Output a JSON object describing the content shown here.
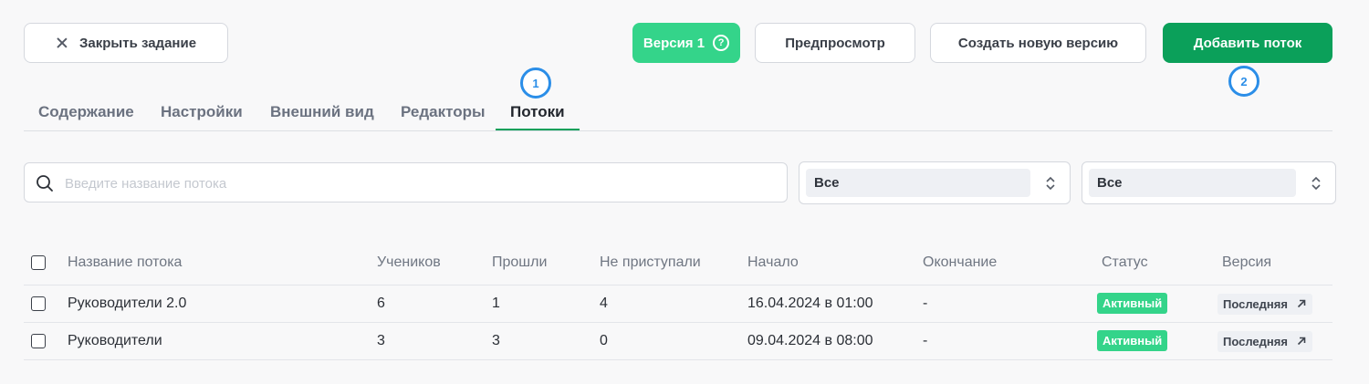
{
  "toolbar": {
    "close_label": "Закрыть задание",
    "version_label": "Версия 1",
    "help_glyph": "?",
    "preview_label": "Предпросмотр",
    "new_version_label": "Создать новую версию",
    "add_stream_label": "Добавить поток"
  },
  "markers": [
    "1",
    "2"
  ],
  "tabs": [
    {
      "label": "Содержание",
      "active": false
    },
    {
      "label": "Настройки",
      "active": false
    },
    {
      "label": "Внешний вид",
      "active": false
    },
    {
      "label": "Редакторы",
      "active": false
    },
    {
      "label": "Потоки",
      "active": true
    }
  ],
  "filters": {
    "search_placeholder": "Введите название потока",
    "search_value": "",
    "select1_value": "Все",
    "select2_value": "Все"
  },
  "table": {
    "columns": [
      "Название потока",
      "Учеников",
      "Прошли",
      "Не приступали",
      "Начало",
      "Окончание",
      "Статус",
      "Версия"
    ],
    "rows": [
      {
        "name": "Руководители 2.0",
        "students": "6",
        "passed": "1",
        "not_started": "4",
        "start": "16.04.2024 в 01:00",
        "end": "-",
        "status": "Активный",
        "version": "Последняя"
      },
      {
        "name": "Руководители",
        "students": "3",
        "passed": "3",
        "not_started": "0",
        "start": "09.04.2024 в 08:00",
        "end": "-",
        "status": "Активный",
        "version": "Последняя"
      }
    ]
  },
  "colors": {
    "primary_green": "#0ba05a",
    "light_green": "#34d48a",
    "marker_blue": "#2b8ee8",
    "background": "#f8f8f9"
  },
  "icons": [
    "close-icon",
    "help-icon",
    "search-icon",
    "chevron-updown-icon",
    "external-arrow-icon",
    "checkbox-icon"
  ]
}
